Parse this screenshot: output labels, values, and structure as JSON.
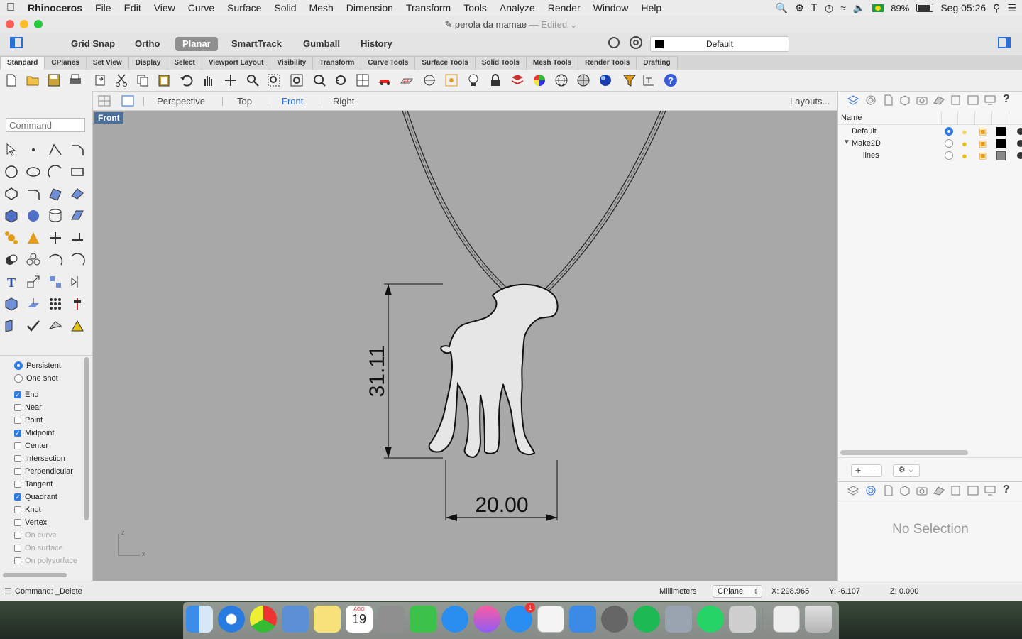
{
  "menubar": {
    "apple_icon": "apple-icon",
    "app_name": "Rhinoceros",
    "items": [
      "File",
      "Edit",
      "View",
      "Curve",
      "Surface",
      "Solid",
      "Mesh",
      "Dimension",
      "Transform",
      "Tools",
      "Analyze",
      "Render",
      "Window",
      "Help"
    ],
    "battery": "89%",
    "clock": "Seg 05:26"
  },
  "window": {
    "title": "perola da mamae",
    "edited": "— Edited"
  },
  "toolbar": {
    "grid_snap": "Grid Snap",
    "ortho": "Ortho",
    "planar": "Planar",
    "smarttrack": "SmartTrack",
    "gumball": "Gumball",
    "history": "History",
    "layer_value": "Default",
    "layer_color": "#000000"
  },
  "tabs": [
    "Standard",
    "CPlanes",
    "Set View",
    "Display",
    "Select",
    "Viewport Layout",
    "Visibility",
    "Transform",
    "Curve Tools",
    "Surface Tools",
    "Solid Tools",
    "Mesh Tools",
    "Render Tools",
    "Drafting"
  ],
  "command": {
    "placeholder": "Command",
    "last": "Command: _Delete"
  },
  "viewport_tabs": {
    "items": [
      "Perspective",
      "Top",
      "Front",
      "Right"
    ],
    "active": "Front",
    "layouts": "Layouts..."
  },
  "viewport": {
    "label": "Front",
    "dim_height": "31.11",
    "dim_width": "20.00",
    "axis_z": "z",
    "axis_x": "x"
  },
  "osnap": {
    "mode": [
      {
        "label": "Persistent",
        "selected": true
      },
      {
        "label": "One shot",
        "selected": false
      }
    ],
    "snaps": [
      {
        "label": "End",
        "checked": true,
        "enabled": true
      },
      {
        "label": "Near",
        "checked": false,
        "enabled": true
      },
      {
        "label": "Point",
        "checked": false,
        "enabled": true
      },
      {
        "label": "Midpoint",
        "checked": true,
        "enabled": true
      },
      {
        "label": "Center",
        "checked": false,
        "enabled": true
      },
      {
        "label": "Intersection",
        "checked": false,
        "enabled": true
      },
      {
        "label": "Perpendicular",
        "checked": false,
        "enabled": true
      },
      {
        "label": "Tangent",
        "checked": false,
        "enabled": true
      },
      {
        "label": "Quadrant",
        "checked": true,
        "enabled": true
      },
      {
        "label": "Knot",
        "checked": false,
        "enabled": true
      },
      {
        "label": "Vertex",
        "checked": false,
        "enabled": true
      },
      {
        "label": "On curve",
        "checked": false,
        "enabled": false
      },
      {
        "label": "On surface",
        "checked": false,
        "enabled": false
      },
      {
        "label": "On polysurface",
        "checked": false,
        "enabled": false
      }
    ]
  },
  "layers": {
    "header_name": "Name",
    "rows": [
      {
        "name": "Default",
        "current": true,
        "color": "#000000"
      },
      {
        "name": "Make2D",
        "current": false,
        "color": "#000000",
        "expanded": true
      },
      {
        "name": "lines",
        "current": false,
        "color": "#888888"
      }
    ]
  },
  "properties": {
    "empty_text": "No Selection"
  },
  "status": {
    "units": "Millimeters",
    "cplane": "CPlane",
    "x": "X: 298.965",
    "y": "Y: -6.107",
    "z": "Z: 0.000"
  },
  "dock": {
    "calendar_month": "AGO",
    "calendar_day": "19",
    "appstore_badge": "1"
  }
}
